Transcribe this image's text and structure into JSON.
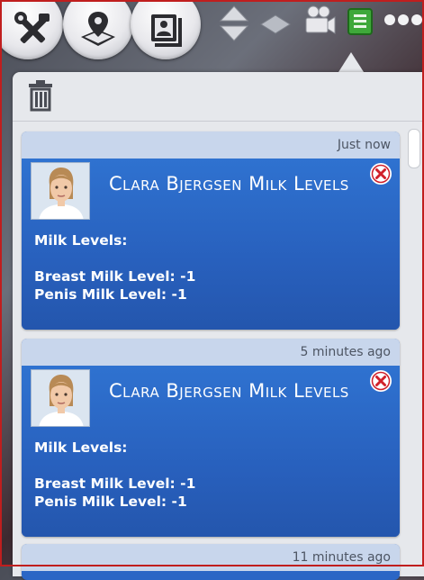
{
  "toolbar": {
    "buttons": [
      {
        "name": "tools",
        "icon": "tools-icon"
      },
      {
        "name": "map",
        "icon": "map-pin-icon"
      },
      {
        "name": "photos",
        "icon": "photo-album-icon"
      },
      {
        "name": "camera-up-down",
        "icon": "up-down-arrows-icon"
      },
      {
        "name": "view-floor",
        "icon": "floor-diamond-icon"
      },
      {
        "name": "camera",
        "icon": "video-camera-icon"
      },
      {
        "name": "notifications",
        "icon": "notification-list-icon"
      },
      {
        "name": "more",
        "icon": "more-dots-icon"
      }
    ]
  },
  "notifications": [
    {
      "time": "Just now",
      "title": "Clara Bjergsen Milk Levels",
      "heading": "Milk Levels:",
      "line1": "Breast Milk Level: -1",
      "line2": "Penis Milk Level: -1"
    },
    {
      "time": "5 minutes ago",
      "title": "Clara Bjergsen Milk Levels",
      "heading": "Milk Levels:",
      "line1": "Breast Milk Level: -1",
      "line2": "Penis Milk Level: -1"
    },
    {
      "time": "11 minutes ago"
    }
  ],
  "colors": {
    "card_blue": "#2b66c5",
    "card_header": "#c8d6ec",
    "panel_bg": "#e6e8ec",
    "close_red": "#d0202a",
    "active_green": "#3fa83a"
  }
}
